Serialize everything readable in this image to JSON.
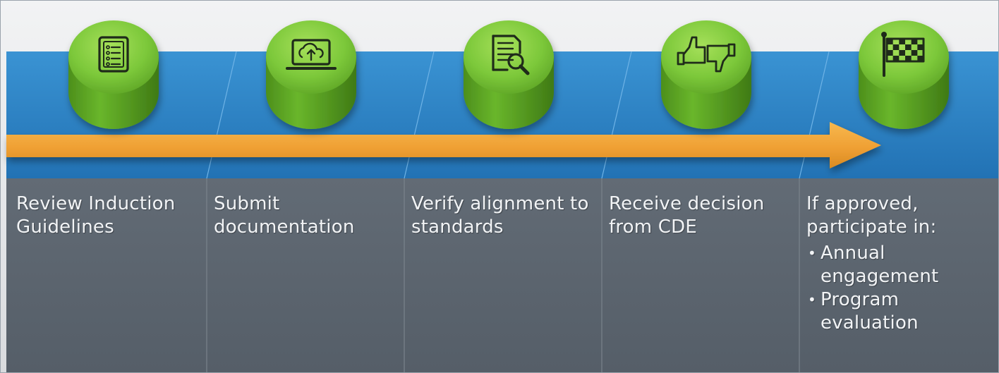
{
  "colors": {
    "panel_blue": "#2e86c6",
    "panel_gray": "#5d6670",
    "puck_green": "#6ab82e",
    "arrow_orange": "#f0a33a",
    "icon_dark": "#1f2b1a",
    "label_text": "#f2f4f6"
  },
  "steps": [
    {
      "icon": "checklist-icon",
      "title": "Review Induction Guidelines",
      "bullets": []
    },
    {
      "icon": "laptop-upload-icon",
      "title": "Submit documentation",
      "bullets": []
    },
    {
      "icon": "document-search-icon",
      "title": "Verify alignment to standards",
      "bullets": []
    },
    {
      "icon": "thumbs-up-down-icon",
      "title": "Receive decision from CDE",
      "bullets": []
    },
    {
      "icon": "checkered-flag-icon",
      "title": "If approved, participate in:",
      "bullets": [
        "Annual engagement",
        "Program evaluation"
      ]
    }
  ]
}
